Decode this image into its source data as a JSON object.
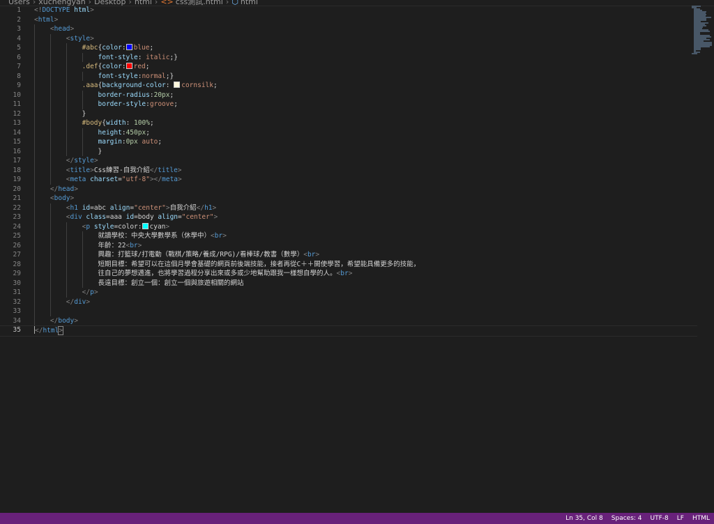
{
  "breadcrumb": [
    "Users",
    "xuchengyan",
    "Desktop",
    "html",
    "css測試.html",
    "html"
  ],
  "statusbar": {
    "position": "Ln 35, Col 8",
    "spaces": "Spaces: 4",
    "encoding": "UTF-8",
    "eol": "LF",
    "language": "HTML"
  },
  "colors": {
    "statusbar": "#68217a",
    "background": "#1e1e1e",
    "swatch_blue": "#0000ff",
    "swatch_red": "#ff0000",
    "swatch_cornsilk": "#fff8dc",
    "swatch_cyan": "#00ffff"
  },
  "editor": {
    "current_line": 35,
    "lines": [
      [
        [
          "pun",
          "<!"
        ],
        [
          "tag",
          "DOCTYPE"
        ],
        [
          "txt",
          " "
        ],
        [
          "attr",
          "html"
        ],
        [
          "pun",
          ">"
        ]
      ],
      [
        [
          "pun",
          "<"
        ],
        [
          "tag",
          "html"
        ],
        [
          "pun",
          ">"
        ]
      ],
      [
        [
          "txt",
          "    "
        ],
        [
          "pun",
          "<"
        ],
        [
          "tag",
          "head"
        ],
        [
          "pun",
          ">"
        ]
      ],
      [
        [
          "txt",
          "        "
        ],
        [
          "pun",
          "<"
        ],
        [
          "tag",
          "style"
        ],
        [
          "pun",
          ">"
        ]
      ],
      [
        [
          "txt",
          "            "
        ],
        [
          "sel",
          "#abc"
        ],
        [
          "txt",
          "{"
        ],
        [
          "prop",
          "color"
        ],
        [
          "txt",
          ":"
        ],
        [
          "swatch",
          "#0000ff"
        ],
        [
          "str",
          "blue"
        ],
        [
          "txt",
          ";"
        ]
      ],
      [
        [
          "txt",
          "                "
        ],
        [
          "prop",
          "font-style"
        ],
        [
          "txt",
          ": "
        ],
        [
          "str",
          "italic"
        ],
        [
          "txt",
          ";}"
        ]
      ],
      [
        [
          "txt",
          "            "
        ],
        [
          "sel",
          ".def"
        ],
        [
          "txt",
          "{"
        ],
        [
          "prop",
          "color"
        ],
        [
          "txt",
          ":"
        ],
        [
          "swatch",
          "#ff0000"
        ],
        [
          "str",
          "red"
        ],
        [
          "txt",
          ";"
        ]
      ],
      [
        [
          "txt",
          "                "
        ],
        [
          "prop",
          "font-style"
        ],
        [
          "txt",
          ":"
        ],
        [
          "str",
          "normal"
        ],
        [
          "txt",
          ";}"
        ]
      ],
      [
        [
          "txt",
          "            "
        ],
        [
          "sel",
          ".aaa"
        ],
        [
          "txt",
          "{"
        ],
        [
          "prop",
          "background-color"
        ],
        [
          "txt",
          ": "
        ],
        [
          "swatch",
          "#fff8dc"
        ],
        [
          "str",
          "cornsilk"
        ],
        [
          "txt",
          ";"
        ]
      ],
      [
        [
          "txt",
          "                "
        ],
        [
          "prop",
          "border-radius"
        ],
        [
          "txt",
          ":"
        ],
        [
          "num",
          "20px"
        ],
        [
          "txt",
          ";"
        ]
      ],
      [
        [
          "txt",
          "                "
        ],
        [
          "prop",
          "border-style"
        ],
        [
          "txt",
          ":"
        ],
        [
          "str",
          "groove"
        ],
        [
          "txt",
          ";"
        ]
      ],
      [
        [
          "txt",
          "            }"
        ]
      ],
      [
        [
          "txt",
          "            "
        ],
        [
          "sel",
          "#body"
        ],
        [
          "txt",
          "{"
        ],
        [
          "prop",
          "width"
        ],
        [
          "txt",
          ": "
        ],
        [
          "num",
          "100%"
        ],
        [
          "txt",
          ";"
        ]
      ],
      [
        [
          "txt",
          "                "
        ],
        [
          "prop",
          "height"
        ],
        [
          "txt",
          ":"
        ],
        [
          "num",
          "450px"
        ],
        [
          "txt",
          ";"
        ]
      ],
      [
        [
          "txt",
          "                "
        ],
        [
          "prop",
          "margin"
        ],
        [
          "txt",
          ":"
        ],
        [
          "num",
          "0px"
        ],
        [
          "txt",
          " "
        ],
        [
          "str",
          "auto"
        ],
        [
          "txt",
          ";"
        ]
      ],
      [
        [
          "txt",
          "                }"
        ]
      ],
      [
        [
          "txt",
          "        "
        ],
        [
          "pun",
          "</"
        ],
        [
          "tag",
          "style"
        ],
        [
          "pun",
          ">"
        ]
      ],
      [
        [
          "txt",
          "        "
        ],
        [
          "pun",
          "<"
        ],
        [
          "tag",
          "title"
        ],
        [
          "pun",
          ">"
        ],
        [
          "txt",
          "Css練習-自我介紹"
        ],
        [
          "pun",
          "</"
        ],
        [
          "tag",
          "title"
        ],
        [
          "pun",
          ">"
        ]
      ],
      [
        [
          "txt",
          "        "
        ],
        [
          "pun",
          "<"
        ],
        [
          "tag",
          "meta"
        ],
        [
          "txt",
          " "
        ],
        [
          "attr",
          "charset"
        ],
        [
          "txt",
          "="
        ],
        [
          "str",
          "\"utf-8\""
        ],
        [
          "pun",
          "></"
        ],
        [
          "tag",
          "meta"
        ],
        [
          "pun",
          ">"
        ]
      ],
      [
        [
          "txt",
          "    "
        ],
        [
          "pun",
          "</"
        ],
        [
          "tag",
          "head"
        ],
        [
          "pun",
          ">"
        ]
      ],
      [
        [
          "txt",
          "    "
        ],
        [
          "pun",
          "<"
        ],
        [
          "tag",
          "body"
        ],
        [
          "pun",
          ">"
        ]
      ],
      [
        [
          "txt",
          "        "
        ],
        [
          "pun",
          "<"
        ],
        [
          "tag",
          "h1"
        ],
        [
          "txt",
          " "
        ],
        [
          "attr",
          "id"
        ],
        [
          "txt",
          "=abc "
        ],
        [
          "attr",
          "align"
        ],
        [
          "txt",
          "="
        ],
        [
          "str",
          "\"center\""
        ],
        [
          "pun",
          ">"
        ],
        [
          "txt",
          "自我介紹"
        ],
        [
          "pun",
          "</"
        ],
        [
          "tag",
          "h1"
        ],
        [
          "pun",
          ">"
        ]
      ],
      [
        [
          "txt",
          "        "
        ],
        [
          "pun",
          "<"
        ],
        [
          "tag",
          "div"
        ],
        [
          "txt",
          " "
        ],
        [
          "attr",
          "class"
        ],
        [
          "txt",
          "=aaa "
        ],
        [
          "attr",
          "id"
        ],
        [
          "txt",
          "=body "
        ],
        [
          "attr",
          "align"
        ],
        [
          "txt",
          "="
        ],
        [
          "str",
          "\"center\""
        ],
        [
          "pun",
          ">"
        ]
      ],
      [
        [
          "txt",
          "            "
        ],
        [
          "pun",
          "<"
        ],
        [
          "tag",
          "p"
        ],
        [
          "txt",
          " "
        ],
        [
          "attr",
          "style"
        ],
        [
          "txt",
          "=color:"
        ],
        [
          "swatch",
          "#00ffff"
        ],
        [
          "txt",
          "cyan"
        ],
        [
          "pun",
          ">"
        ]
      ],
      [
        [
          "txt",
          "                就讀學校：中央大學數學系（休學中）"
        ],
        [
          "pun",
          "<"
        ],
        [
          "tag",
          "br"
        ],
        [
          "pun",
          ">"
        ]
      ],
      [
        [
          "txt",
          "                年齡：22"
        ],
        [
          "pun",
          "<"
        ],
        [
          "tag",
          "br"
        ],
        [
          "pun",
          ">"
        ]
      ],
      [
        [
          "txt",
          "                興趣：打籃球/打電動（戰棋/策略/養成/RPG)/看棒球/教書（數學）"
        ],
        [
          "pun",
          "<"
        ],
        [
          "tag",
          "br"
        ],
        [
          "pun",
          ">"
        ]
      ],
      [
        [
          "txt",
          "                短期目標：希望可以在這個月學會基礎的網頁前後端技能，接者再從C＋＋開使學習，希望能具備更多的技能，"
        ]
      ],
      [
        [
          "txt",
          "                往自己的夢想邁進，也將學習過程分享出來或多或少地幫助跟我一樣想自學的人。"
        ],
        [
          "pun",
          "<"
        ],
        [
          "tag",
          "br"
        ],
        [
          "pun",
          ">"
        ]
      ],
      [
        [
          "txt",
          "                長遠目標：創立一個：創立一個與旅遊相關的網站"
        ]
      ],
      [
        [
          "txt",
          "            "
        ],
        [
          "pun",
          "</"
        ],
        [
          "tag",
          "p"
        ],
        [
          "pun",
          ">"
        ]
      ],
      [
        [
          "txt",
          "        "
        ],
        [
          "pun",
          "</"
        ],
        [
          "tag",
          "div"
        ],
        [
          "pun",
          ">"
        ]
      ],
      [
        [
          "txt",
          ""
        ]
      ],
      [
        [
          "txt",
          "    "
        ],
        [
          "pun",
          "</"
        ],
        [
          "tag",
          "body"
        ],
        [
          "pun",
          ">"
        ]
      ],
      [
        [
          "cursorpun",
          "</"
        ],
        [
          "tag",
          "html"
        ],
        [
          "bracket",
          ">"
        ]
      ]
    ]
  }
}
